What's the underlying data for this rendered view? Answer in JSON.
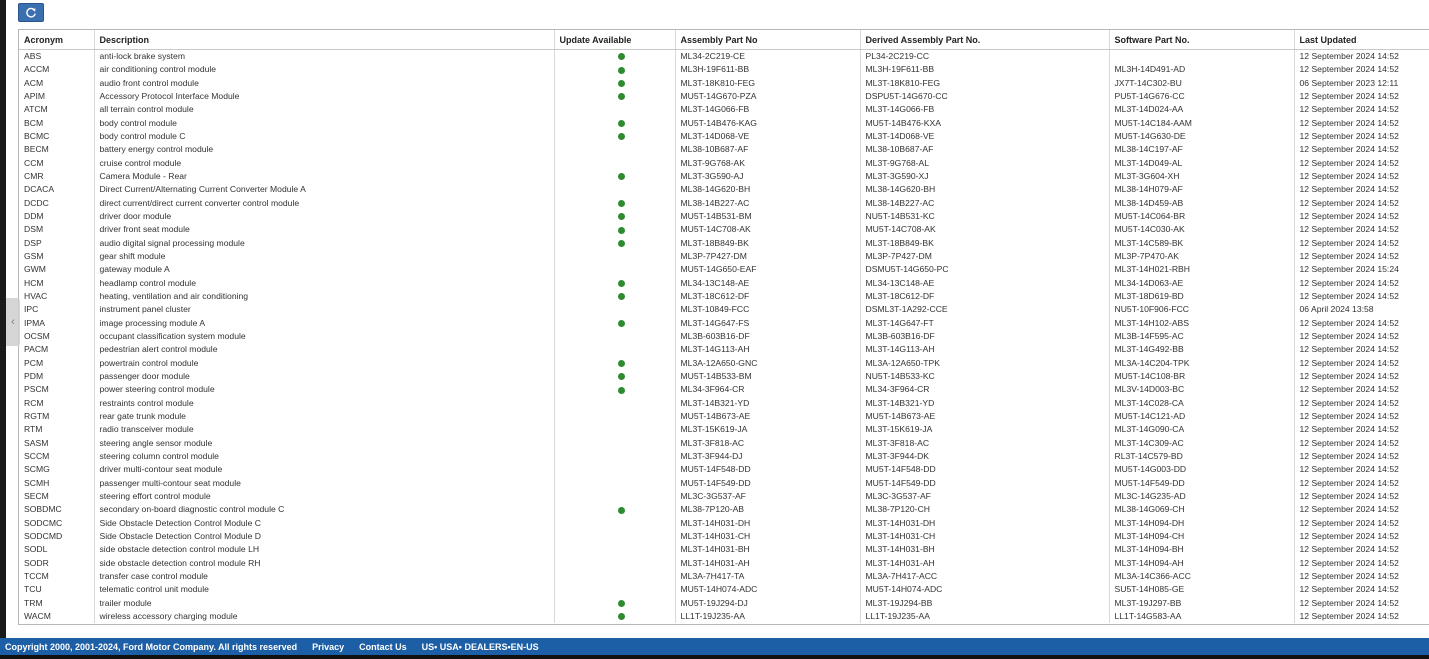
{
  "toolbar": {
    "refresh_icon": "refresh-icon"
  },
  "columns": [
    "Acronym",
    "Description",
    "Update Available",
    "Assembly Part No",
    "Derived Assembly Part No.",
    "Software Part No.",
    "Last Updated"
  ],
  "rows": [
    [
      "ABS",
      "anti-lock brake system",
      true,
      "ML34-2C219-CE",
      "PL34-2C219-CC",
      "",
      "12 September 2024 14:52"
    ],
    [
      "ACCM",
      "air conditioning control module",
      true,
      "ML3H-19F611-BB",
      "ML3H-19F611-BB",
      "ML3H-14D491-AD",
      "12 September 2024 14:52"
    ],
    [
      "ACM",
      "audio front control module",
      true,
      "ML3T-18K810-FEG",
      "ML3T-18K810-FEG",
      "JX7T-14C302-BU",
      "06 September 2023 12:11"
    ],
    [
      "APIM",
      "Accessory Protocol Interface Module",
      true,
      "MU5T-14G670-PZA",
      "DSPU5T-14G670-CC",
      "PU5T-14G676-CC",
      "12 September 2024 14:52"
    ],
    [
      "ATCM",
      "all terrain control module",
      false,
      "ML3T-14G066-FB",
      "ML3T-14G066-FB",
      "ML3T-14D024-AA",
      "12 September 2024 14:52"
    ],
    [
      "BCM",
      "body control module",
      true,
      "MU5T-14B476-KAG",
      "MU5T-14B476-KXA",
      "MU5T-14C184-AAM",
      "12 September 2024 14:52"
    ],
    [
      "BCMC",
      "body control module C",
      true,
      "ML3T-14D068-VE",
      "ML3T-14D068-VE",
      "MU5T-14G630-DE",
      "12 September 2024 14:52"
    ],
    [
      "BECM",
      "battery energy control module",
      false,
      "ML38-10B687-AF",
      "ML38-10B687-AF",
      "ML38-14C197-AF",
      "12 September 2024 14:52"
    ],
    [
      "CCM",
      "cruise control module",
      false,
      "ML3T-9G768-AK",
      "ML3T-9G768-AL",
      "ML3T-14D049-AL",
      "12 September 2024 14:52"
    ],
    [
      "CMR",
      "Camera Module - Rear",
      true,
      "ML3T-3G590-AJ",
      "ML3T-3G590-XJ",
      "ML3T-3G604-XH",
      "12 September 2024 14:52"
    ],
    [
      "DCACA",
      "Direct Current/Alternating Current Converter Module A",
      false,
      "ML38-14G620-BH",
      "ML38-14G620-BH",
      "ML38-14H079-AF",
      "12 September 2024 14:52"
    ],
    [
      "DCDC",
      "direct current/direct current converter control module",
      true,
      "ML38-14B227-AC",
      "ML38-14B227-AC",
      "ML38-14D459-AB",
      "12 September 2024 14:52"
    ],
    [
      "DDM",
      "driver door module",
      true,
      "MU5T-14B531-BM",
      "NU5T-14B531-KC",
      "MU5T-14C064-BR",
      "12 September 2024 14:52"
    ],
    [
      "DSM",
      "driver front seat module",
      true,
      "MU5T-14C708-AK",
      "MU5T-14C708-AK",
      "MU5T-14C030-AK",
      "12 September 2024 14:52"
    ],
    [
      "DSP",
      "audio digital signal processing module",
      true,
      "ML3T-18B849-BK",
      "ML3T-18B849-BK",
      "ML3T-14C589-BK",
      "12 September 2024 14:52"
    ],
    [
      "GSM",
      "gear shift module",
      false,
      "ML3P-7P427-DM",
      "ML3P-7P427-DM",
      "ML3P-7P470-AK",
      "12 September 2024 14:52"
    ],
    [
      "GWM",
      "gateway module A",
      false,
      "MU5T-14G650-EAF",
      "DSMU5T-14G650-PC",
      "ML3T-14H021-RBH",
      "12 September 2024 15:24"
    ],
    [
      "HCM",
      "headlamp control module",
      true,
      "ML34-13C148-AE",
      "ML34-13C148-AE",
      "ML34-14D063-AE",
      "12 September 2024 14:52"
    ],
    [
      "HVAC",
      "heating, ventilation and air conditioning",
      true,
      "ML3T-18C612-DF",
      "ML3T-18C612-DF",
      "ML3T-18D619-BD",
      "12 September 2024 14:52"
    ],
    [
      "IPC",
      "instrument panel cluster",
      false,
      "ML3T-10849-FCC",
      "DSML3T-1A292-CCE",
      "NU5T-10F906-FCC",
      "06 April 2024 13:58"
    ],
    [
      "IPMA",
      "image processing module A",
      true,
      "ML3T-14G647-FS",
      "ML3T-14G647-FT",
      "ML3T-14H102-ABS",
      "12 September 2024 14:52"
    ],
    [
      "OCSM",
      "occupant classification system module",
      false,
      "ML3B-603B16-DF",
      "ML3B-603B16-DF",
      "ML3B-14F595-AC",
      "12 September 2024 14:52"
    ],
    [
      "PACM",
      "pedestrian alert control module",
      false,
      "ML3T-14G113-AH",
      "ML3T-14G113-AH",
      "ML3T-14G492-BB",
      "12 September 2024 14:52"
    ],
    [
      "PCM",
      "powertrain control module",
      true,
      "ML3A-12A650-GNC",
      "ML3A-12A650-TPK",
      "ML3A-14C204-TPK",
      "12 September 2024 14:52"
    ],
    [
      "PDM",
      "passenger door module",
      true,
      "MU5T-14B533-BM",
      "NU5T-14B533-KC",
      "MU5T-14C108-BR",
      "12 September 2024 14:52"
    ],
    [
      "PSCM",
      "power steering control module",
      true,
      "ML34-3F964-CR",
      "ML34-3F964-CR",
      "ML3V-14D003-BC",
      "12 September 2024 14:52"
    ],
    [
      "RCM",
      "restraints control module",
      false,
      "ML3T-14B321-YD",
      "ML3T-14B321-YD",
      "ML3T-14C028-CA",
      "12 September 2024 14:52"
    ],
    [
      "RGTM",
      "rear gate trunk module",
      false,
      "MU5T-14B673-AE",
      "MU5T-14B673-AE",
      "MU5T-14C121-AD",
      "12 September 2024 14:52"
    ],
    [
      "RTM",
      "radio transceiver module",
      false,
      "ML3T-15K619-JA",
      "ML3T-15K619-JA",
      "ML3T-14G090-CA",
      "12 September 2024 14:52"
    ],
    [
      "SASM",
      "steering angle sensor module",
      false,
      "ML3T-3F818-AC",
      "ML3T-3F818-AC",
      "ML3T-14C309-AC",
      "12 September 2024 14:52"
    ],
    [
      "SCCM",
      "steering column control module",
      false,
      "ML3T-3F944-DJ",
      "ML3T-3F944-DK",
      "RL3T-14C579-BD",
      "12 September 2024 14:52"
    ],
    [
      "SCMG",
      "driver multi-contour seat module",
      false,
      "MU5T-14F548-DD",
      "MU5T-14F548-DD",
      "MU5T-14G003-DD",
      "12 September 2024 14:52"
    ],
    [
      "SCMH",
      "passenger multi-contour seat module",
      false,
      "MU5T-14F549-DD",
      "MU5T-14F549-DD",
      "MU5T-14F549-DD",
      "12 September 2024 14:52"
    ],
    [
      "SECM",
      "steering effort control module",
      false,
      "ML3C-3G537-AF",
      "ML3C-3G537-AF",
      "ML3C-14G235-AD",
      "12 September 2024 14:52"
    ],
    [
      "SOBDMC",
      "secondary on-board diagnostic control module C",
      true,
      "ML38-7P120-AB",
      "ML38-7P120-CH",
      "ML38-14G069-CH",
      "12 September 2024 14:52"
    ],
    [
      "SODCMC",
      "Side Obstacle Detection Control Module C",
      false,
      "ML3T-14H031-DH",
      "ML3T-14H031-DH",
      "ML3T-14H094-DH",
      "12 September 2024 14:52"
    ],
    [
      "SODCMD",
      "Side Obstacle Detection Control Module D",
      false,
      "ML3T-14H031-CH",
      "ML3T-14H031-CH",
      "ML3T-14H094-CH",
      "12 September 2024 14:52"
    ],
    [
      "SODL",
      "side obstacle detection control module LH",
      false,
      "ML3T-14H031-BH",
      "ML3T-14H031-BH",
      "ML3T-14H094-BH",
      "12 September 2024 14:52"
    ],
    [
      "SODR",
      "side obstacle detection control module RH",
      false,
      "ML3T-14H031-AH",
      "ML3T-14H031-AH",
      "ML3T-14H094-AH",
      "12 September 2024 14:52"
    ],
    [
      "TCCM",
      "transfer case control module",
      false,
      "ML3A-7H417-TA",
      "ML3A-7H417-ACC",
      "ML3A-14C366-ACC",
      "12 September 2024 14:52"
    ],
    [
      "TCU",
      "telematic control unit module",
      false,
      "MU5T-14H074-ADC",
      "MU5T-14H074-ADC",
      "SU5T-14H085-GE",
      "12 September 2024 14:52"
    ],
    [
      "TRM",
      "trailer module",
      true,
      "MU5T-19J294-DJ",
      "ML3T-19J294-BB",
      "ML3T-19J297-BB",
      "12 September 2024 14:52"
    ],
    [
      "WACM",
      "wireless accessory charging module",
      true,
      "LL1T-19J235-AA",
      "LL1T-19J235-AA",
      "LL1T-14G583-AA",
      "12 September 2024 14:52"
    ]
  ],
  "footer": {
    "copyright": "Copyright 2000, 2001-2024, Ford Motor Company. All rights reserved",
    "privacy": "Privacy",
    "contact": "Contact Us",
    "locale": "US• USA• DEALERS•EN-US"
  },
  "colors": {
    "accent": "#3a6fb0",
    "footer_bg": "#1d5fa6",
    "dot": "#2e8b2e"
  }
}
